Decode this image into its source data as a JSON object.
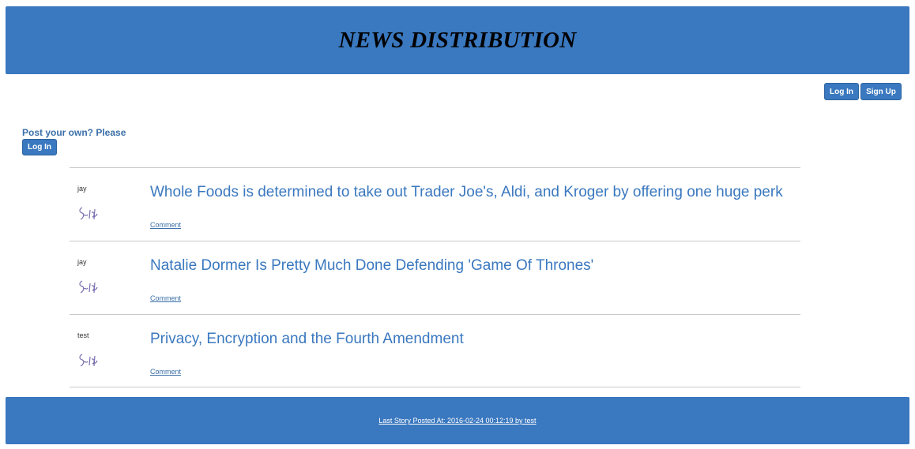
{
  "header": {
    "title": "NEWS DISTRIBUTION"
  },
  "auth": {
    "login_label": "Log In",
    "signup_label": "Sign Up"
  },
  "post_prompt": {
    "text": "Post your own? Please",
    "login_label": "Log In"
  },
  "stories": [
    {
      "author": "jay",
      "title": "Whole Foods is determined to take out Trader Joe's, Aldi, and Kroger by offering one huge perk",
      "comment_label": "Comment"
    },
    {
      "author": "jay",
      "title": "Natalie Dormer Is Pretty Much Done Defending 'Game Of Thrones'",
      "comment_label": "Comment"
    },
    {
      "author": "test",
      "title": "Privacy, Encryption and the Fourth Amendment",
      "comment_label": "Comment"
    }
  ],
  "footer": {
    "last_story": "Last Story Posted At: 2016-02-24 00:12:19 by test"
  },
  "colors": {
    "accent": "#3a78bf",
    "title_text": "#000000",
    "divider": "#c9c9c9"
  },
  "icons": {
    "signature": "signature-image"
  }
}
